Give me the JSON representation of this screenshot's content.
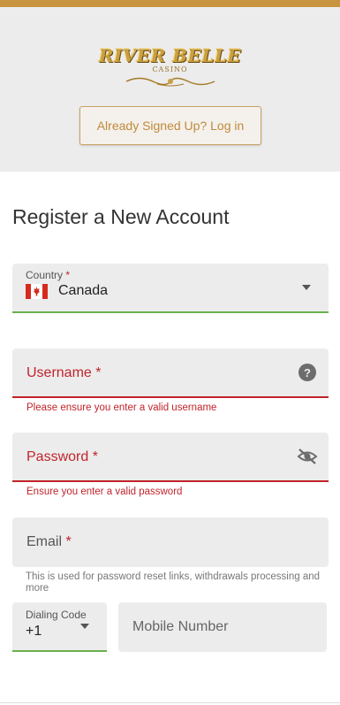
{
  "brand": {
    "logo_main": "RIVER BELLE",
    "logo_sub": "CASINO",
    "accent": "#c89440"
  },
  "header": {
    "login_button": "Already Signed Up? Log in"
  },
  "form": {
    "title": "Register a New Account",
    "country": {
      "label": "Country",
      "required_mark": "*",
      "value": "Canada",
      "flag_icon": "canada-flag-icon"
    },
    "username": {
      "label": "Username *",
      "error": "Please ensure you enter a valid username",
      "icon": "help-icon"
    },
    "password": {
      "label": "Password *",
      "error": "Ensure you enter a valid password",
      "icon": "eye-off-icon"
    },
    "email": {
      "label": "Email",
      "required_mark": "*",
      "help": "This is used for password reset links, withdrawals processing and more"
    },
    "dialing_code": {
      "label": "Dialing Code",
      "value": "+1"
    },
    "mobile": {
      "placeholder": "Mobile Number"
    }
  },
  "colors": {
    "error": "#c0242b",
    "valid": "#6ab04c",
    "field_bg": "#ececec"
  }
}
